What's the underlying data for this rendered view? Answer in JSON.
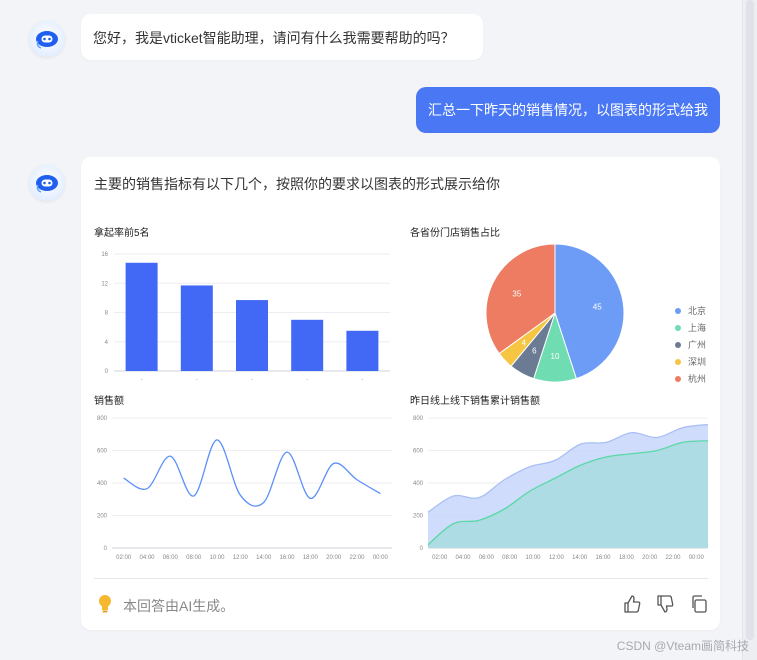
{
  "messages": {
    "greeting": "您好，我是vticket智能助理，请问有什么我需要帮助的吗？",
    "user_query": "汇总一下昨天的销售情况，以图表的形式给我",
    "answer_intro": "主要的销售指标有以下几个，按照你的要求以图表的形式展示给你"
  },
  "footer": {
    "disclaimer": "本回答由AI生成。",
    "actions": [
      "thumbs-up-icon",
      "thumbs-down-icon",
      "copy-icon"
    ]
  },
  "watermark": "CSDN @Vteam画简科技",
  "colors": {
    "accent": "#4a78f5",
    "bar": "#4169f6",
    "line": "#5b8ff9",
    "area_online": "#c7d6fb",
    "area_offline": "#a8dce0",
    "area_offline_line": "#5ad8a6"
  },
  "chart_data": [
    {
      "type": "bar",
      "title": "拿起率前5名",
      "categories": [
        "",
        "",
        "",
        "",
        ""
      ],
      "values": [
        14.8,
        11.7,
        9.7,
        7.0,
        5.5
      ],
      "yticks": [
        "0",
        "4",
        "8",
        "12",
        "16"
      ],
      "ylim": [
        0,
        16
      ],
      "grid": true
    },
    {
      "type": "pie",
      "title": "各省份门店销售占比",
      "slices": [
        {
          "name": "北京",
          "value": 45,
          "color": "#6d9cf7"
        },
        {
          "name": "上海",
          "value": 10,
          "color": "#6fdcb2"
        },
        {
          "name": "广州",
          "value": 6,
          "color": "#6c7b94"
        },
        {
          "name": "深圳",
          "value": 4,
          "color": "#f6c542"
        },
        {
          "name": "杭州",
          "value": 35,
          "color": "#ed7c62"
        }
      ],
      "legend": "right"
    },
    {
      "type": "line",
      "title": "销售额",
      "x": [
        "02:00",
        "04:00",
        "06:00",
        "08:00",
        "10:00",
        "12:00",
        "14:00",
        "16:00",
        "18:00",
        "20:00",
        "22:00",
        "00:00"
      ],
      "series": [
        {
          "values": [
            430,
            365,
            565,
            320,
            665,
            325,
            280,
            590,
            305,
            520,
            420,
            335
          ]
        }
      ],
      "yticks": [
        "0",
        "200",
        "400",
        "600",
        "800"
      ],
      "ylim": [
        0,
        800
      ],
      "grid": true
    },
    {
      "type": "area",
      "title": "昨日线上线下销售累计销售额",
      "x": [
        "02:00",
        "04:00",
        "06:00",
        "08:00",
        "10:00",
        "12:00",
        "14:00",
        "16:00",
        "18:00",
        "20:00",
        "22:00",
        "00:00"
      ],
      "series": [
        {
          "values": [
            220,
            320,
            310,
            420,
            500,
            540,
            640,
            650,
            710,
            680,
            740,
            760
          ]
        },
        {
          "values": [
            20,
            150,
            170,
            240,
            350,
            430,
            510,
            560,
            580,
            600,
            650,
            660
          ]
        }
      ],
      "yticks": [
        "0",
        "200",
        "400",
        "600",
        "800"
      ],
      "ylim": [
        0,
        800
      ],
      "grid": true
    }
  ]
}
